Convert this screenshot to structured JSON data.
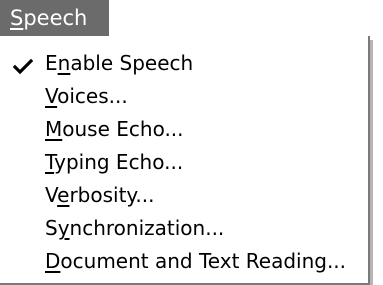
{
  "menubar": {
    "title": {
      "pre": "",
      "key": "S",
      "post": "peech"
    }
  },
  "menu": {
    "items": [
      {
        "pre": "E",
        "key": "n",
        "post": "able Speech",
        "checked": true,
        "icon": "check-icon"
      },
      {
        "pre": "",
        "key": "V",
        "post": "oices...",
        "checked": false
      },
      {
        "pre": "",
        "key": "M",
        "post": "ouse Echo...",
        "checked": false
      },
      {
        "pre": "",
        "key": "T",
        "post": "yping Echo...",
        "checked": false
      },
      {
        "pre": "V",
        "key": "e",
        "post": "rbosity...",
        "checked": false
      },
      {
        "pre": "S",
        "key": "y",
        "post": "nchronization...",
        "checked": false
      },
      {
        "pre": "",
        "key": "D",
        "post": "ocument and Text Reading...",
        "checked": false
      }
    ]
  }
}
